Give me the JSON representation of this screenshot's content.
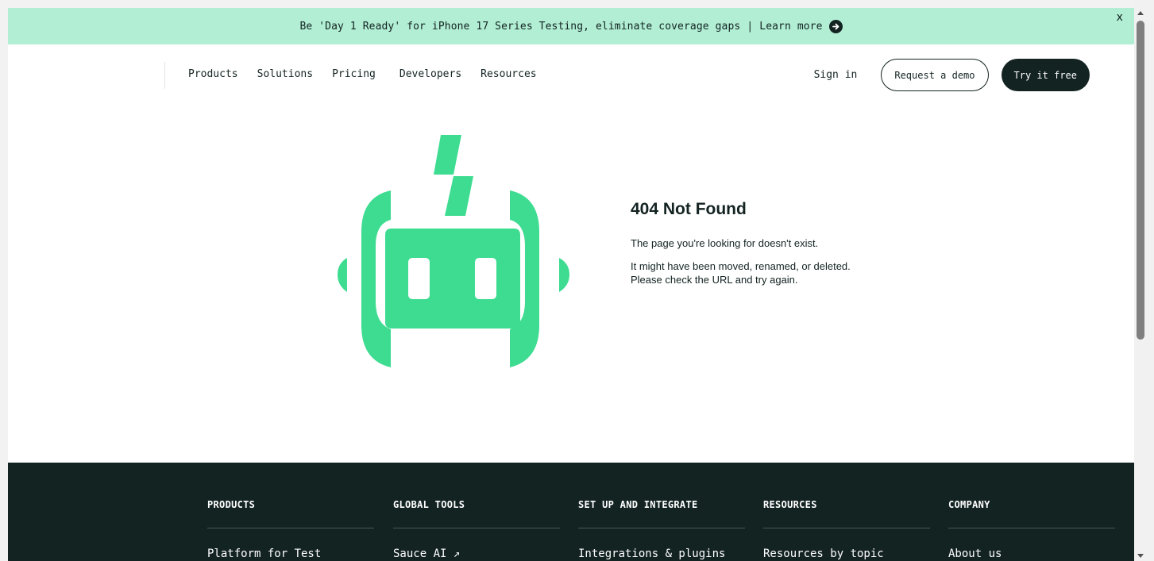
{
  "banner": {
    "text": "Be 'Day 1 Ready' for iPhone 17 Series Testing, eliminate coverage gaps",
    "separator": "|",
    "link_label": "Learn more",
    "close_label": "x",
    "arrow_icon": "arrow-right-circle-icon"
  },
  "nav": {
    "items": [
      {
        "label": "Products"
      },
      {
        "label": "Solutions"
      },
      {
        "label": "Pricing"
      },
      {
        "label": "Developers"
      },
      {
        "label": "Resources"
      }
    ],
    "sign_in": "Sign in",
    "request_demo": "Request a demo",
    "try_free": "Try it free"
  },
  "main": {
    "title": "404 Not Found",
    "line1": "The page you're looking for doesn't exist.",
    "line2": "It might have been moved, renamed, or deleted. Please check the URL and try again.",
    "illustration_icon": "robot-icon"
  },
  "footer": {
    "columns": [
      {
        "heading": "PRODUCTS",
        "first_link": "Platform for Test"
      },
      {
        "heading": "GLOBAL TOOLS",
        "first_link": "Sauce AI ↗"
      },
      {
        "heading": "SET UP AND INTEGRATE",
        "first_link": "Integrations & plugins"
      },
      {
        "heading": "RESOURCES",
        "first_link": "Resources by topic"
      },
      {
        "heading": "COMPANY",
        "first_link": "About us"
      }
    ]
  },
  "colors": {
    "banner_bg": "#b1eed4",
    "brand_green": "#3ddc91",
    "dark": "#132322",
    "white": "#ffffff"
  }
}
